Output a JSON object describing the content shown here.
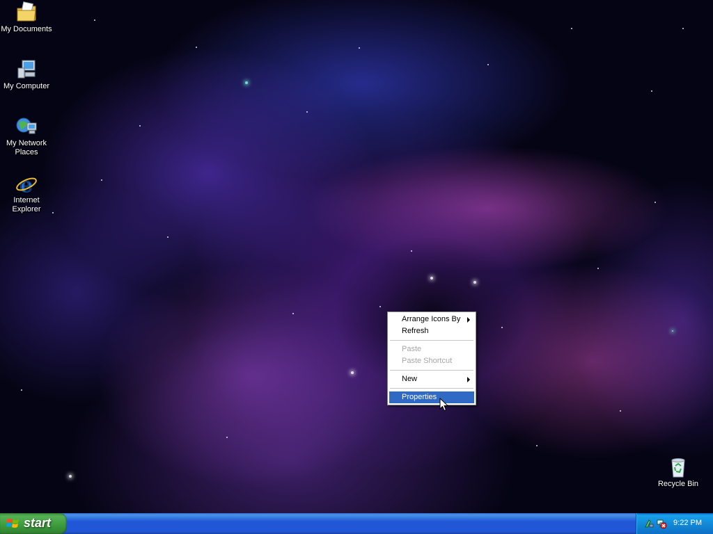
{
  "desktop": {
    "icons": [
      {
        "label": "My Documents",
        "icon": "my-documents-icon"
      },
      {
        "label": "My Computer",
        "icon": "my-computer-icon"
      },
      {
        "label": "My Network Places",
        "icon": "network-places-icon"
      },
      {
        "label": "Internet Explorer",
        "icon": "internet-explorer-icon"
      },
      {
        "label": "Recycle Bin",
        "icon": "recycle-bin-icon"
      }
    ]
  },
  "context_menu": {
    "items": [
      {
        "label": "Arrange Icons By",
        "has_submenu": true,
        "enabled": true
      },
      {
        "label": "Refresh",
        "enabled": true
      },
      {
        "label": "Paste",
        "enabled": false
      },
      {
        "label": "Paste Shortcut",
        "enabled": false
      },
      {
        "label": "New",
        "has_submenu": true,
        "enabled": true
      },
      {
        "label": "Properties",
        "enabled": true,
        "selected": true
      }
    ]
  },
  "taskbar": {
    "start_label": "start",
    "clock": "9:22 PM",
    "tray_icons": [
      "safely-remove-hardware-icon",
      "network-disconnected-icon"
    ]
  },
  "colors": {
    "taskbar_blue": "#2157d7",
    "start_green": "#3c9a3c",
    "menu_highlight": "#316ac5",
    "tray_blue": "#128ad9"
  }
}
